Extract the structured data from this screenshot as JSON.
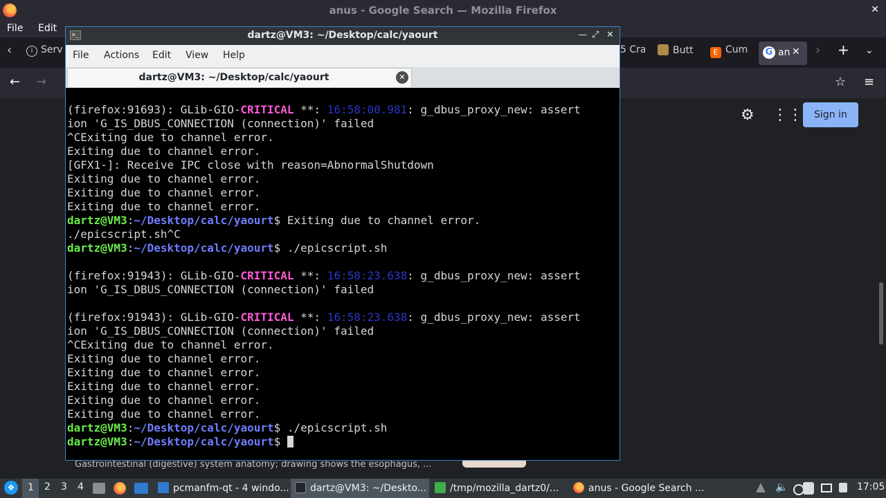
{
  "firefox": {
    "window_title": "anus - Google Search — Mozilla Firefox",
    "menu": [
      "File",
      "Edit"
    ],
    "tabs": [
      {
        "label": "Serv"
      },
      {
        "label": "5 Cra"
      },
      {
        "label": "Butt"
      },
      {
        "label": "Cum"
      },
      {
        "label": "an"
      }
    ],
    "google": {
      "sign_in": "Sign in",
      "snippet": "Gastrointestinal (digestive) system anatomy; drawing shows the esophagus, ..."
    }
  },
  "terminal": {
    "title": "dartz@VM3: ~/Desktop/calc/yaourt",
    "menu": [
      "File",
      "Actions",
      "Edit",
      "View",
      "Help"
    ],
    "tab_label": "dartz@VM3: ~/Desktop/calc/yaourt",
    "prompt_user": "dartz@VM3",
    "prompt_path": "~/Desktop/calc/yaourt",
    "lines": [
      {
        "type": "crit",
        "pre": "(firefox:91693): GLib-GIO-",
        "crit": "CRITICAL",
        "mid": " **: ",
        "ts": "16:58:00.981",
        "post": ": g_dbus_proxy_new: assert"
      },
      {
        "type": "text",
        "text": "ion 'G_IS_DBUS_CONNECTION (connection)' failed"
      },
      {
        "type": "text",
        "text": "^CExiting due to channel error."
      },
      {
        "type": "text",
        "text": "Exiting due to channel error."
      },
      {
        "type": "text",
        "text": "[GFX1-]: Receive IPC close with reason=AbnormalShutdown"
      },
      {
        "type": "text",
        "text": "Exiting due to channel error."
      },
      {
        "type": "text",
        "text": "Exiting due to channel error."
      },
      {
        "type": "text",
        "text": "Exiting due to channel error."
      },
      {
        "type": "prompt",
        "cmd": "Exiting due to channel error."
      },
      {
        "type": "text",
        "text": "./epicscript.sh^C"
      },
      {
        "type": "prompt",
        "cmd": "./epicscript.sh"
      },
      {
        "type": "text",
        "text": ""
      },
      {
        "type": "crit",
        "pre": "(firefox:91943): GLib-GIO-",
        "crit": "CRITICAL",
        "mid": " **: ",
        "ts": "16:58:23.638",
        "post": ": g_dbus_proxy_new: assert"
      },
      {
        "type": "text",
        "text": "ion 'G_IS_DBUS_CONNECTION (connection)' failed"
      },
      {
        "type": "text",
        "text": ""
      },
      {
        "type": "crit",
        "pre": "(firefox:91943): GLib-GIO-",
        "crit": "CRITICAL",
        "mid": " **: ",
        "ts": "16:58:23.638",
        "post": ": g_dbus_proxy_new: assert"
      },
      {
        "type": "text",
        "text": "ion 'G_IS_DBUS_CONNECTION (connection)' failed"
      },
      {
        "type": "text",
        "text": "^CExiting due to channel error."
      },
      {
        "type": "text",
        "text": "Exiting due to channel error."
      },
      {
        "type": "text",
        "text": "Exiting due to channel error."
      },
      {
        "type": "text",
        "text": "Exiting due to channel error."
      },
      {
        "type": "text",
        "text": "Exiting due to channel error."
      },
      {
        "type": "text",
        "text": "Exiting due to channel error."
      },
      {
        "type": "prompt",
        "cmd": "./epicscript.sh"
      },
      {
        "type": "prompt",
        "cmd": "",
        "cursor": true
      }
    ]
  },
  "taskbar": {
    "workspaces": [
      "1",
      "2",
      "3",
      "4"
    ],
    "tasks": [
      {
        "label": "pcmanfm-qt - 4 windo..."
      },
      {
        "label": "dartz@VM3: ~/Deskto..."
      },
      {
        "label": "/tmp/mozilla_dartz0/..."
      },
      {
        "label": "anus - Google Search ..."
      }
    ],
    "clock": "17:05"
  }
}
